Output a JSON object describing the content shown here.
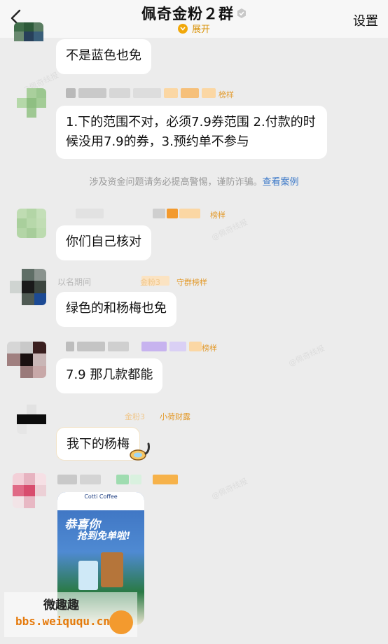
{
  "header": {
    "title": "佩奇金粉２群",
    "expand_label": "展开",
    "settings_label": "设置"
  },
  "messages": [
    {
      "text": "不是蓝色也免"
    },
    {
      "tag": "榜样",
      "text": "1.下的范围不对，必须7.9券范围  2.付款的时候没用7.9的券，3.预约单不参与"
    },
    {
      "tag": "榜样",
      "text": "你们自己核对"
    },
    {
      "name_partial": "以名期间",
      "tags": [
        "金粉3",
        "守群榜样"
      ],
      "text": "绿色的和杨梅也免"
    },
    {
      "tag": "榜样",
      "text": "7.9 那几款都能"
    },
    {
      "tags": [
        "金粉3",
        "小荷财露"
      ],
      "text": "我下的杨梅"
    },
    {
      "image": {
        "brand": "Cotti Coffee",
        "headline_1": "恭喜你",
        "headline_2": "抢到免单啦!"
      }
    }
  ],
  "notice": {
    "text": "涉及资金问题请务必提高警惕，谨防诈骗。",
    "link": "查看案例"
  },
  "watermark": {
    "line1": "微趣趣",
    "line2": "bbs.weiququ.cn"
  },
  "colors": {
    "accent_gold": "#d9930a",
    "tag_orange": "#e39a2b",
    "link_blue": "#3b78c8",
    "chat_bg": "#ececec"
  }
}
